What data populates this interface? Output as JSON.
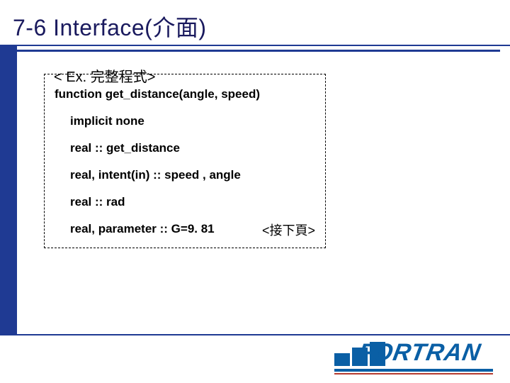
{
  "title": "7-6 Interface(介面)",
  "legend": "< Ex. 完整程式>",
  "code": {
    "l1": "function get_distance(angle, speed)",
    "l2": "implicit none",
    "l3": "real :: get_distance",
    "l4": "real, intent(in) :: speed , angle",
    "l5": "real :: rad",
    "l6": "real, parameter :: G=9. 81"
  },
  "next_page": "<接下頁>",
  "logo_text": "FORTRAN"
}
